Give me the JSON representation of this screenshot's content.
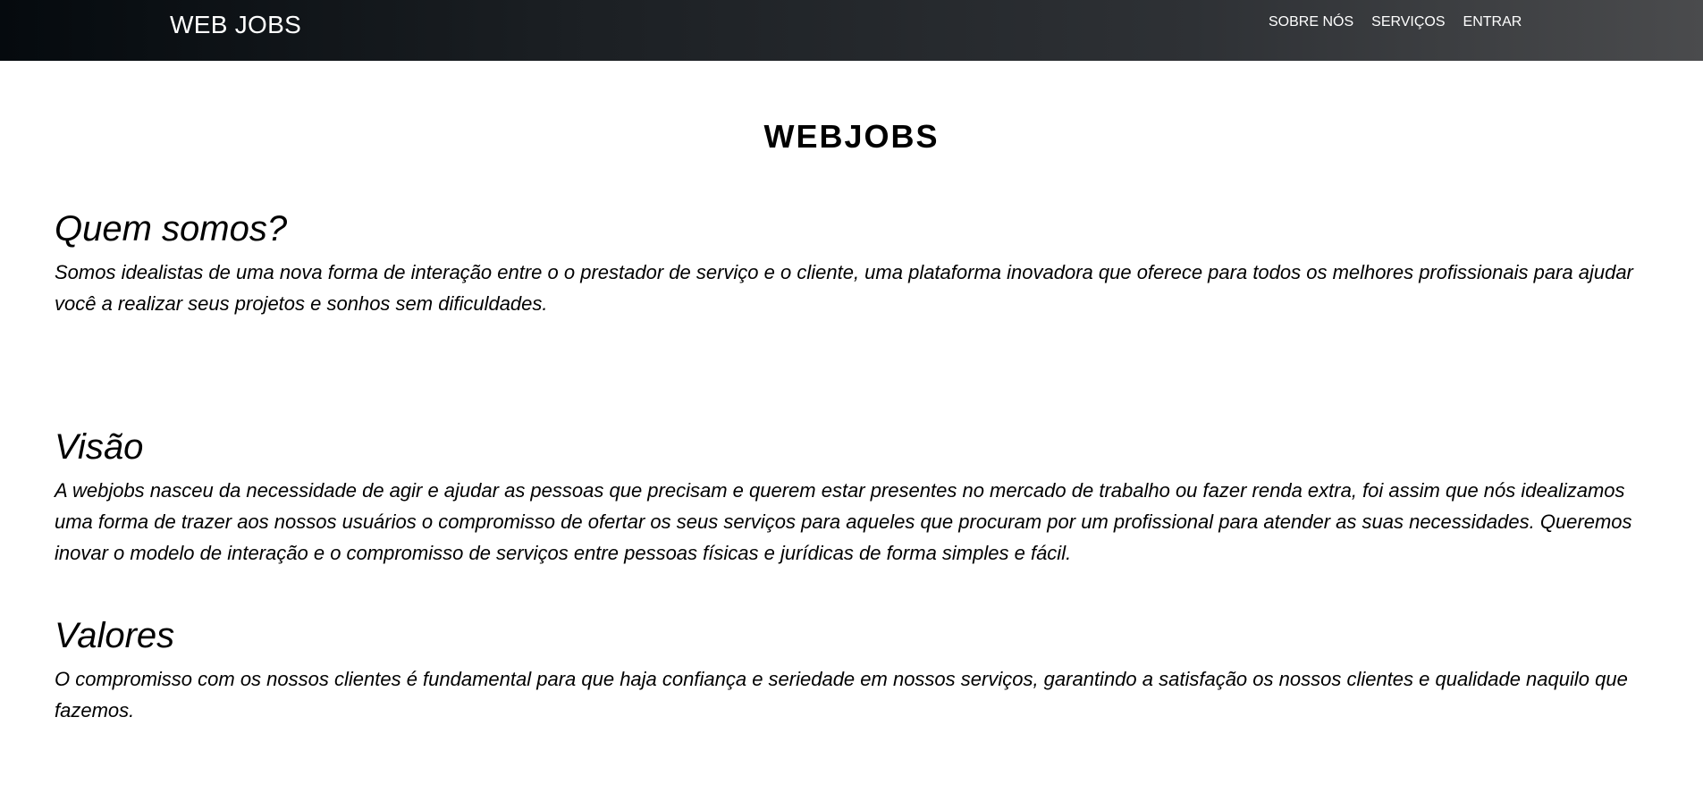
{
  "header": {
    "brand": "WEB JOBS",
    "links": [
      {
        "label": "SOBRE NÓS"
      },
      {
        "label": "SERVIÇOS"
      },
      {
        "label": "ENTRAR"
      }
    ]
  },
  "main": {
    "title": "WEBJOBS",
    "sections": [
      {
        "heading": "Quem somos?",
        "text": "Somos idealistas de uma nova forma de interação entre o o prestador de serviço e o cliente, uma plataforma inovadora que oferece para todos os melhores profissionais para ajudar você a realizar seus projetos e sonhos sem dificuldades."
      },
      {
        "heading": "Visão",
        "text": "A webjobs nasceu da necessidade de agir e ajudar as pessoas que precisam e querem estar presentes no mercado de trabalho ou fazer renda extra, foi assim que nós idealizamos uma forma de trazer aos nossos usuários o compromisso de ofertar os seus serviços para aqueles que procuram por um profissional para atender as suas necessidades. Queremos inovar o modelo de interação e o compromisso de serviços entre pessoas físicas e jurídicas de forma simples e fácil."
      },
      {
        "heading": "Valores",
        "text": "O compromisso com os nossos clientes é fundamental para que haja confiança e seriedade em nossos serviços, garantindo a satisfação os nossos clientes e qualidade naquilo que fazemos."
      }
    ]
  }
}
